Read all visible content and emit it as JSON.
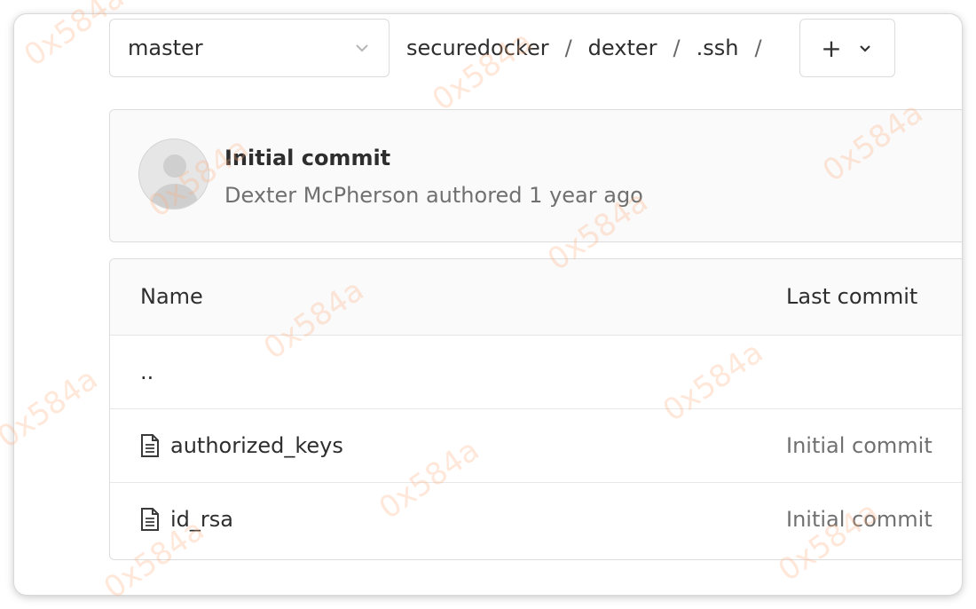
{
  "repo": {
    "branch_selector": {
      "selected": "master"
    },
    "breadcrumb": [
      "securedocker",
      "dexter",
      ".ssh"
    ],
    "breadcrumb_separator": "/",
    "add_button": {
      "label": "+"
    }
  },
  "last_commit": {
    "title": "Initial commit",
    "author": "Dexter McPherson",
    "action": "authored",
    "time": "1 year ago"
  },
  "file_table": {
    "headers": {
      "name": "Name",
      "last_commit": "Last commit"
    },
    "parent_dir": "..",
    "files": [
      {
        "name": "authorized_keys",
        "last_commit": "Initial commit",
        "icon": "file-icon"
      },
      {
        "name": "id_rsa",
        "last_commit": "Initial commit",
        "icon": "file-icon"
      }
    ]
  },
  "watermark": {
    "text": "0x584a"
  }
}
